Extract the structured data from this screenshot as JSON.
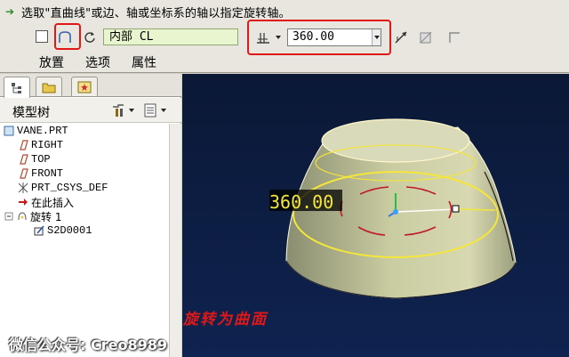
{
  "prompt": {
    "text": "选取\"直曲线\"或边、轴或坐标系的轴以指定旋转轴。"
  },
  "toolbar": {
    "reference_value": "内部 CL",
    "angle_value": "360.00"
  },
  "tabs": [
    "放置",
    "选项",
    "属性"
  ],
  "left_panel": {
    "title": "模型树",
    "tree": [
      {
        "label": "VANE.PRT",
        "icon": "part-icon"
      },
      {
        "label": "RIGHT",
        "icon": "datum-plane-icon"
      },
      {
        "label": "TOP",
        "icon": "datum-plane-icon"
      },
      {
        "label": "FRONT",
        "icon": "datum-plane-icon"
      },
      {
        "label": "PRT_CSYS_DEF",
        "icon": "csys-icon"
      },
      {
        "label": "在此插入",
        "icon": "insert-here-icon"
      },
      {
        "label": "旋转 1",
        "icon": "revolve-icon"
      },
      {
        "label": "S2D0001",
        "icon": "sketch-icon"
      }
    ]
  },
  "viewport": {
    "dimension_label": "360.00",
    "background": "#0c1a3a"
  },
  "caption": "旋转为曲面",
  "watermark": "微信公众号: Creo8989",
  "colors": {
    "highlight": "#e01818",
    "model_fill": "#cfd1a6",
    "sketch": "#f5e63a"
  }
}
